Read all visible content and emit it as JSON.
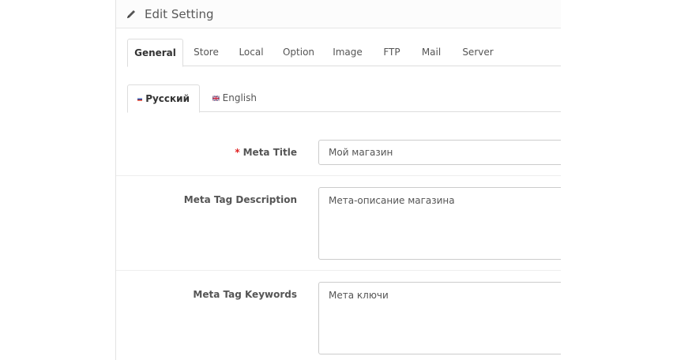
{
  "heading": {
    "title": "Edit Setting",
    "icon": "pencil-icon"
  },
  "tabs": [
    {
      "label": "General",
      "active": true
    },
    {
      "label": "Store",
      "active": false
    },
    {
      "label": "Local",
      "active": false
    },
    {
      "label": "Option",
      "active": false
    },
    {
      "label": "Image",
      "active": false
    },
    {
      "label": "FTP",
      "active": false
    },
    {
      "label": "Mail",
      "active": false
    },
    {
      "label": "Server",
      "active": false
    }
  ],
  "languages": [
    {
      "label": "Русский",
      "active": true,
      "flag": "ru-flag-icon"
    },
    {
      "label": "English",
      "active": false,
      "flag": "uk-flag-icon"
    }
  ],
  "form": {
    "meta_title": {
      "required_mark": "*",
      "label": "Meta Title",
      "value": "Мой магазин"
    },
    "meta_description": {
      "label": "Meta Tag Description",
      "value": "Мета-описание магазина"
    },
    "meta_keywords": {
      "label": "Meta Tag Keywords",
      "value": "Мета ключи"
    }
  },
  "colors": {
    "required": "#e02222",
    "border": "#dddddd"
  }
}
